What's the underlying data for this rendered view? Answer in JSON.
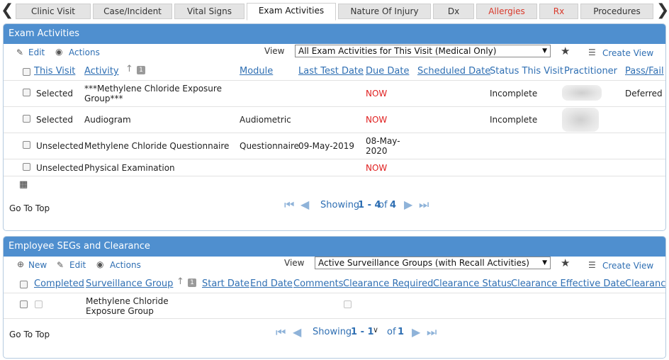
{
  "tabs": [
    {
      "label": "Clinic Visit",
      "active": false,
      "red": false
    },
    {
      "label": "Case/Incident",
      "active": false,
      "red": false
    },
    {
      "label": "Vital Signs",
      "active": false,
      "red": false
    },
    {
      "label": "Exam Activities",
      "active": true,
      "red": false
    },
    {
      "label": "Nature Of Injury",
      "active": false,
      "red": false
    },
    {
      "label": "Dx",
      "active": false,
      "red": false
    },
    {
      "label": "Allergies",
      "active": false,
      "red": true
    },
    {
      "label": "Rx",
      "active": false,
      "red": true
    },
    {
      "label": "Procedures",
      "active": false,
      "red": false
    }
  ],
  "exam": {
    "title": "Exam Activities",
    "toolbar": {
      "edit": "Edit",
      "actions": "Actions",
      "view_label": "View",
      "view_value": "All Exam Activities for This Visit (Medical Only)",
      "create_view": "Create View"
    },
    "columns": {
      "this_visit": "This Visit",
      "activity": "Activity",
      "sort_badge": "1",
      "module": "Module",
      "last_test_date": "Last Test Date",
      "due_date": "Due Date",
      "scheduled_date": "Scheduled Date",
      "status_this_visit": "Status This Visit",
      "practitioner": "Practitioner",
      "pass_fail": "Pass/Fail"
    },
    "rows": [
      {
        "this_visit": "Selected",
        "activity": "***Methylene Chloride Exposure Group***",
        "module": "",
        "last_test_date": "",
        "due_date": "NOW",
        "scheduled_date": "",
        "status": "Incomplete",
        "pass_fail": "Deferred"
      },
      {
        "this_visit": "Selected",
        "activity": "Audiogram",
        "module": "Audiometric",
        "last_test_date": "",
        "due_date": "NOW",
        "scheduled_date": "",
        "status": "Incomplete",
        "pass_fail": ""
      },
      {
        "this_visit": "Unselected",
        "activity": "Methylene Chloride Questionnaire",
        "module": "Questionnaire",
        "last_test_date": "09-May-2019",
        "due_date": "08-May-2020",
        "scheduled_date": "",
        "status": "",
        "pass_fail": ""
      },
      {
        "this_visit": "Unselected",
        "activity": "Physical Examination",
        "module": "",
        "last_test_date": "",
        "due_date": "NOW",
        "scheduled_date": "",
        "status": "",
        "pass_fail": ""
      }
    ],
    "go_to_top": "Go To Top",
    "pager": {
      "showing": "Showing",
      "from_to": "1 - 4",
      "of": "of",
      "total": "4"
    }
  },
  "segs": {
    "title": "Employee SEGs and Clearance",
    "toolbar": {
      "new": "New",
      "edit": "Edit",
      "actions": "Actions",
      "view_label": "View",
      "view_value": "Active Surveillance Groups (with Recall Activities)",
      "create_view": "Create View"
    },
    "columns": {
      "completed": "Completed",
      "surveillance_group": "Surveillance Group",
      "sort_badge": "1",
      "start_date": "Start Date",
      "end_date": "End Date",
      "comments": "Comments",
      "clearance_required": "Clearance Required",
      "clearance_status": "Clearance Status",
      "clearance_effective_date": "Clearance Effective Date",
      "clearance": "Clearance"
    },
    "rows": [
      {
        "surveillance_group": "Methylene Chloride Exposure Group"
      }
    ],
    "go_to_top": "Go To Top",
    "pager": {
      "showing": "Showing",
      "from_to": "1 - 1",
      "of": "of",
      "total": "1"
    }
  }
}
